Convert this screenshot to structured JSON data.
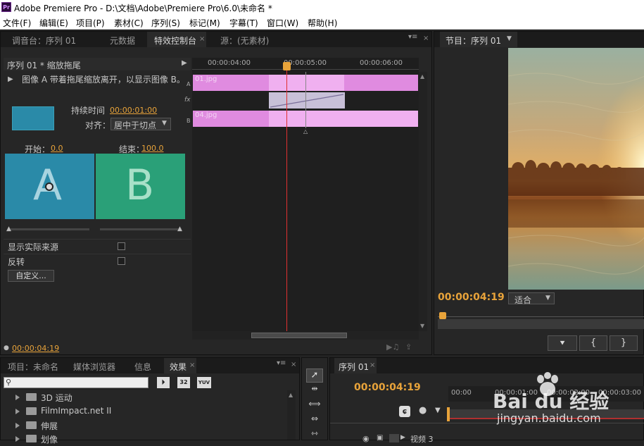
{
  "window": {
    "title": "Adobe Premiere Pro - D:\\文档\\Adobe\\Premiere Pro\\6.0\\未命名 *",
    "app_icon": "Pr"
  },
  "menu": [
    "文件(F)",
    "编辑(E)",
    "项目(P)",
    "素材(C)",
    "序列(S)",
    "标记(M)",
    "字幕(T)",
    "窗口(W)",
    "帮助(H)"
  ],
  "upper_tabs": {
    "mixer": "调音台：序列 01",
    "metadata": "元数据",
    "effect_controls": "特效控制台",
    "source": "源：(无素材)"
  },
  "effect_controls": {
    "header": "序列 01 * 缩放拖尾",
    "description": "图像 A 带着拖尾缩放离开，以显示图像 B。",
    "duration_label": "持续时间",
    "duration_value": "00:00:01:00",
    "align_label": "对齐：",
    "align_value": "居中于切点",
    "start_label": "开始：",
    "start_value": "0.0",
    "end_label": "结束：",
    "end_value": "100.0",
    "preview_a": "A",
    "preview_b": "B",
    "show_actual_sources": "显示实际来源",
    "reverse": "反转",
    "custom_button": "自定义...",
    "ruler_times": [
      "00:00:04:00",
      "00:00:05:00",
      "00:00:06:00"
    ],
    "track_a_label": "A",
    "track_b_label": "B",
    "fx_label": "fx",
    "clip_a_name": "01.jpg",
    "clip_b_name": "04.jpg",
    "current_time": "00:00:04:19"
  },
  "program": {
    "tab_label": "节目：序列 01",
    "timecode": "00:00:04:19",
    "fit_label": "适合"
  },
  "project_tabs": {
    "project": "项目：未命名",
    "media_browser": "媒体浏览器",
    "info": "信息",
    "effects": "效果"
  },
  "effects_panel": {
    "search_placeholder": "",
    "badges": [
      "32",
      "YUV"
    ],
    "tree": [
      "3D 运动",
      "FilmImpact.net II",
      "伸展",
      "划像"
    ]
  },
  "timeline": {
    "tab_label": "序列 01",
    "timecode": "00:00:04:19",
    "ruler": [
      "00:00",
      "00:00:01:00",
      "00:00:02:00",
      "00:00:03:00"
    ],
    "track_label": "视频 3"
  },
  "watermark": {
    "brand": "Bai du 经验",
    "url": "jingyan.baidu.com"
  },
  "colors": {
    "accent_orange": "#e8a33a",
    "clip_pink": "#e08be0",
    "preview_a": "#2a8aa8",
    "preview_b": "#2aa078",
    "playhead": "#e03030"
  }
}
